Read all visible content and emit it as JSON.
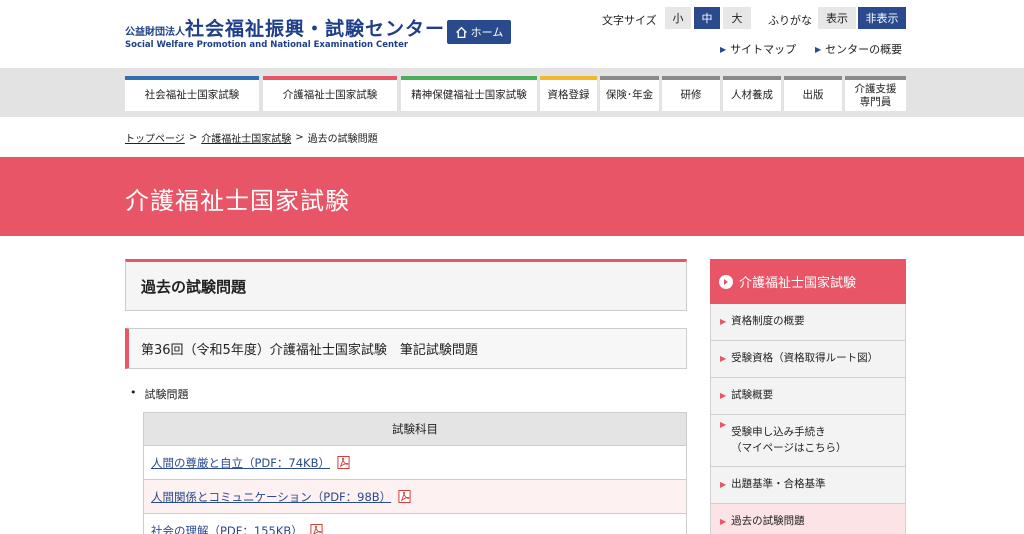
{
  "header": {
    "logo_prefix": "公益財団法人",
    "logo_main": "社会福祉振興・試験センター",
    "logo_en": "Social Welfare Promotion and National Examination Center",
    "home_label": "ホーム",
    "font_size_label": "文字サイズ",
    "font_sizes": [
      "小",
      "中",
      "大"
    ],
    "font_size_selected": "中",
    "furigana_label": "ふりがな",
    "furigana_show": "表示",
    "furigana_hide": "非表示",
    "sitemap": "サイトマップ",
    "center_overview": "センターの概要"
  },
  "nav": {
    "items": [
      {
        "label": "社会福祉士国家試験",
        "color": "#2f6fb0"
      },
      {
        "label": "介護福祉士国家試験",
        "color": "#e85566"
      },
      {
        "label": "精神保健福祉士国家試験",
        "color": "#4bae5a"
      },
      {
        "label": "資格登録",
        "color": "#f0b72f"
      },
      {
        "label": "保険･年金",
        "color": "#8a8a8a"
      },
      {
        "label": "研修",
        "color": "#8a8a8a"
      },
      {
        "label": "人材養成",
        "color": "#8a8a8a"
      },
      {
        "label": "出版",
        "color": "#8a8a8a"
      },
      {
        "label": "介護支援\n専門員",
        "color": "#8a8a8a"
      }
    ]
  },
  "breadcrumb": {
    "top": "トップページ",
    "parent": "介護福祉士国家試験",
    "current": "過去の試験問題"
  },
  "banner": {
    "title": "介護福祉士国家試験"
  },
  "main": {
    "section_title": "過去の試験問題",
    "sub_title": "第36回（令和5年度）介護福祉士国家試験　筆記試験問題",
    "bullet": "試験問題",
    "table_header": "試験科目",
    "rows": [
      "人間の尊厳と自立（PDF：74KB）",
      "人間関係とコミュニケーション（PDF：98B）",
      "社会の理解（PDF：155KB）"
    ]
  },
  "sidebar": {
    "title": "介護福祉士国家試験",
    "items": [
      {
        "label": "資格制度の概要"
      },
      {
        "label": "受験資格（資格取得ルート図）"
      },
      {
        "label": "試験概要"
      },
      {
        "label": "受験申し込み手続き",
        "label2": "（マイページはこちら）"
      },
      {
        "label": "出題基準・合格基準"
      },
      {
        "label": "過去の試験問題"
      }
    ]
  },
  "colors": {
    "accent": "#e85566",
    "navy": "#2a4a8e"
  }
}
